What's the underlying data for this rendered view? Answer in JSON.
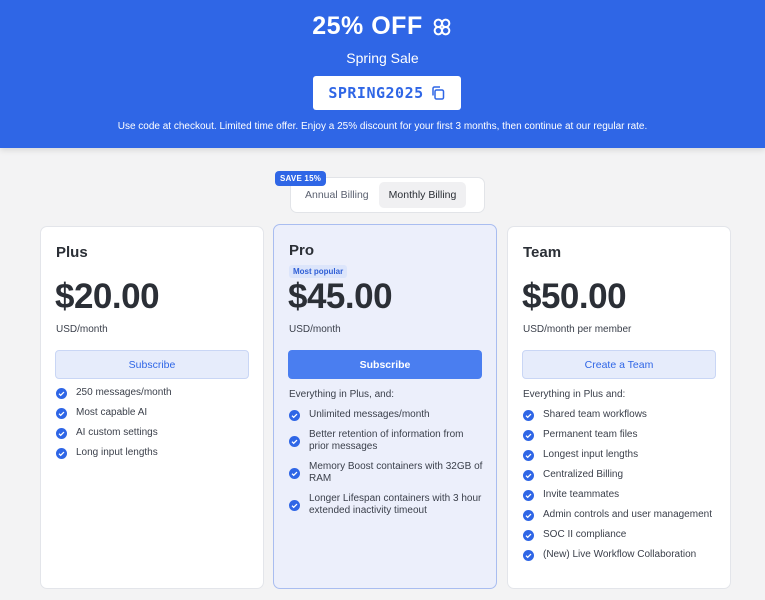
{
  "banner": {
    "title": "25% OFF",
    "subtitle": "Spring Sale",
    "code": "SPRING2025",
    "note": "Use code at checkout. Limited time offer. Enjoy a 25% discount for your first 3 months, then continue at our regular rate."
  },
  "billing": {
    "badge": "SAVE 15%",
    "annual": "Annual Billing",
    "monthly": "Monthly Billing",
    "selected": "monthly"
  },
  "plans": [
    {
      "name": "Plus",
      "price": "$20.00",
      "period": "USD/month",
      "button": "Subscribe",
      "intro": "",
      "features": [
        "250 messages/month",
        "Most capable AI",
        "AI custom settings",
        "Long input lengths"
      ]
    },
    {
      "name": "Pro",
      "badge": "Most popular",
      "price": "$45.00",
      "period": "USD/month",
      "button": "Subscribe",
      "intro": "Everything in Plus, and:",
      "features": [
        "Unlimited messages/month",
        "Better retention of information from prior messages",
        "Memory Boost containers with 32GB of RAM",
        "Longer Lifespan containers with 3 hour extended inactivity timeout"
      ]
    },
    {
      "name": "Team",
      "price": "$50.00",
      "period": "USD/month per member",
      "button": "Create a Team",
      "intro": "Everything in Plus and:",
      "features": [
        "Shared team workflows",
        "Permanent team files",
        "Longest input lengths",
        "Centralized Billing",
        "Invite teammates",
        "Admin controls and user management",
        "SOC II compliance",
        "(New) Live Workflow Collaboration"
      ]
    }
  ],
  "colors": {
    "brand": "#2f66e6",
    "button_solid": "#4a7ef0",
    "check": "#2f66e6"
  }
}
